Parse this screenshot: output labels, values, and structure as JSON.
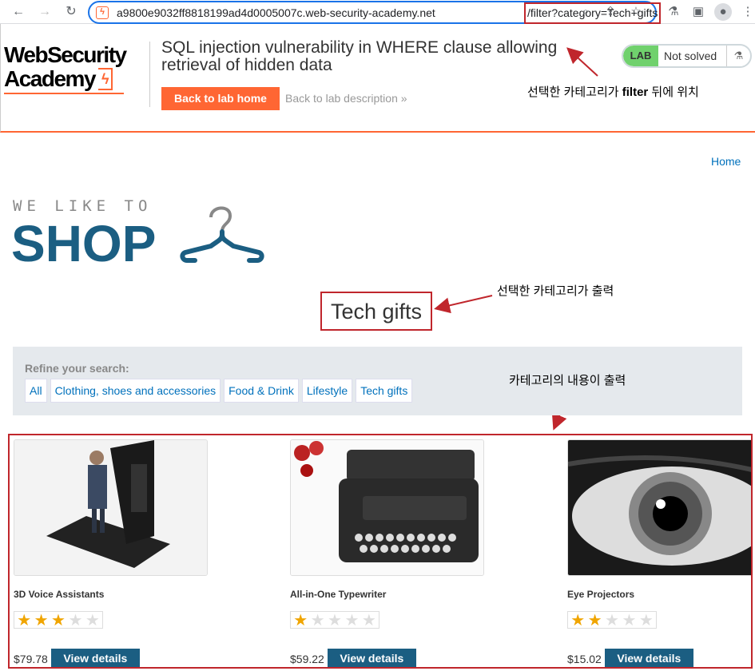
{
  "browser": {
    "url_host": "a9800e9032ff8818199ad4d0005007c.web-security-academy.net",
    "url_path": "/filter?category=Tech+gifts"
  },
  "header": {
    "logo_line1": "WebSecurity",
    "logo_line2": "Academy",
    "lab_title": "SQL injection vulnerability in WHERE clause allowing retrieval of hidden data",
    "back_home": "Back to lab home",
    "back_desc": "Back to lab description",
    "lab_badge": "LAB",
    "lab_status": "Not solved"
  },
  "annotations": {
    "url_note_before": "선택한 카테고리가 ",
    "url_note_bold": "filter",
    "url_note_after": " 뒤에 위치",
    "title_note": "선택한 카테고리가 출력",
    "content_note": "카테고리의 내용이 출력"
  },
  "page": {
    "home_link": "Home",
    "shop_small": "WE LIKE TO",
    "shop_big": "SHOP",
    "category_title": "Tech gifts",
    "refine_label": "Refine your search:",
    "filters": [
      "All",
      "Clothing, shoes and accessories",
      "Food & Drink",
      "Lifestyle",
      "Tech gifts"
    ]
  },
  "products": [
    {
      "name": "3D Voice Assistants",
      "rating": 3,
      "price": "$79.78",
      "button": "View details"
    },
    {
      "name": "All-in-One Typewriter",
      "rating": 1,
      "price": "$59.22",
      "button": "View details"
    },
    {
      "name": "Eye Projectors",
      "rating": 2,
      "price": "$15.02",
      "button": "View details"
    }
  ],
  "colors": {
    "accent": "#ff6633",
    "brand_blue": "#1b5e82",
    "link": "#0071bc",
    "annotation_red": "#c0262c"
  }
}
